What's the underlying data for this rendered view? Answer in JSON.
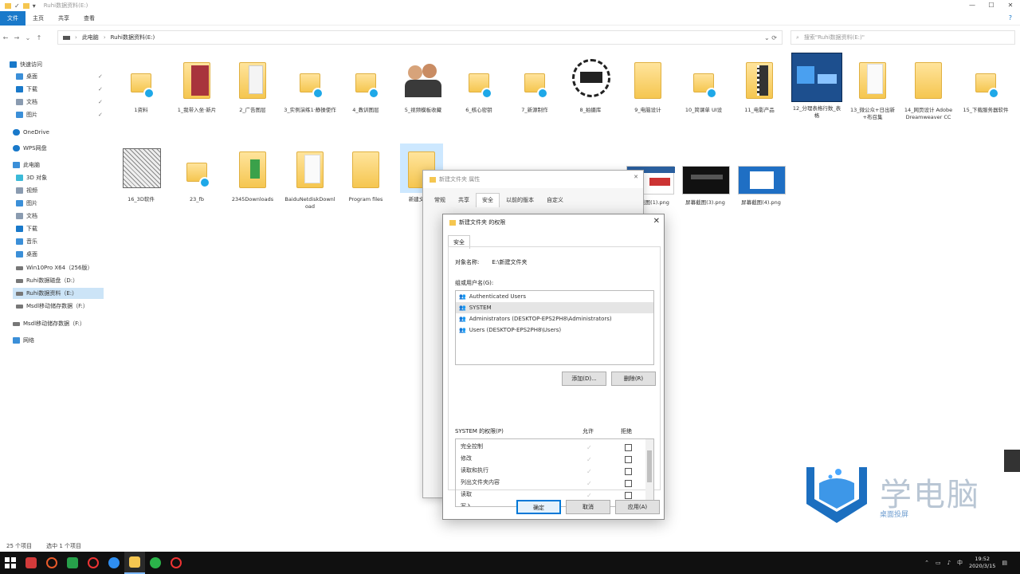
{
  "window": {
    "title": "Ruhi数据资料(E:)",
    "controls": [
      "—",
      "☐",
      "✕"
    ]
  },
  "ribbon": {
    "tabs": [
      "文件",
      "主页",
      "共享",
      "查看"
    ],
    "help": "?"
  },
  "address": {
    "path": [
      "此电脑",
      "Ruhi数据资料(E:)"
    ],
    "search_placeholder": "搜索\"Ruhi数据资料(E:)\""
  },
  "sidebar": {
    "items": [
      {
        "label": "快速访问",
        "color": "#1979ca"
      },
      {
        "label": "桌面",
        "color": "#3b8fd8",
        "pinned": true
      },
      {
        "label": "下载",
        "color": "#1979ca",
        "pinned": true
      },
      {
        "label": "文档",
        "color": "#8a9bb0",
        "pinned": true
      },
      {
        "label": "图片",
        "color": "#3b8fd8",
        "pinned": true
      },
      {
        "label": "OneDrive",
        "color": "#1979ca"
      },
      {
        "label": "WPS网盘",
        "color": "#1979ca"
      },
      {
        "label": "此电脑",
        "color": "#3b8fd8"
      },
      {
        "label": "3D 对象",
        "color": "#3bbad8"
      },
      {
        "label": "视频",
        "color": "#8a9bb0"
      },
      {
        "label": "图片",
        "color": "#3b8fd8"
      },
      {
        "label": "文档",
        "color": "#8a9bb0"
      },
      {
        "label": "下载",
        "color": "#1979ca"
      },
      {
        "label": "音乐",
        "color": "#3b8fd8"
      },
      {
        "label": "桌面",
        "color": "#3b8fd8"
      },
      {
        "label": "Win10Pro X64（256版）",
        "color": "#777777"
      },
      {
        "label": "Ruhi数据磁盘（D:）",
        "color": "#777777"
      },
      {
        "label": "Ruhi数据资料（E:）",
        "color": "#777777",
        "selected": true
      },
      {
        "label": "Msdl移动储存数据（F:）",
        "color": "#777777"
      },
      {
        "label": "Msdl移动储存数据（F:）",
        "color": "#777777"
      },
      {
        "label": "网络",
        "color": "#3b8fd8"
      }
    ]
  },
  "files_row1": [
    {
      "label": "1资料",
      "kind": "folder-badge"
    },
    {
      "label": "1_我带入坐·新片",
      "kind": "red-folder"
    },
    {
      "label": "2_广告图层",
      "kind": "folder-paper"
    },
    {
      "label": "3_实例演练1·静操使作",
      "kind": "folder-badge"
    },
    {
      "label": "4_教训图层",
      "kind": "folder-badge"
    },
    {
      "label": "5_视频模板收藏",
      "kind": "people"
    },
    {
      "label": "6_核心密钥",
      "kind": "folder-badge"
    },
    {
      "label": "7_新源制作",
      "kind": "folder-badge"
    },
    {
      "label": "8_拍摄库",
      "kind": "stamp"
    },
    {
      "label": "9_电脑设计",
      "kind": "folder"
    },
    {
      "label": "10_简课单 UI设",
      "kind": "folder-badge"
    },
    {
      "label": "11_电影产品",
      "kind": "folder-film"
    },
    {
      "label": "12_分理表格行数_表格",
      "kind": "blue-shot"
    },
    {
      "label": "13_微公众+日出新+布召集",
      "kind": "folder-paper"
    },
    {
      "label": "14_网页设计 Adobe Dreamweaver CC",
      "kind": "folder"
    },
    {
      "label": "15_下载服务器软件",
      "kind": "folder-badge"
    }
  ],
  "files_row2": [
    {
      "label": "16_3D软件",
      "kind": "sketch"
    },
    {
      "label": "23_fb",
      "kind": "folder-badge"
    },
    {
      "label": "2345Downloads",
      "kind": "folder-green"
    },
    {
      "label": "BaiduNetdiskDownload",
      "kind": "folder-paper"
    },
    {
      "label": "Program files",
      "kind": "folder"
    },
    {
      "label": "新建文件夹",
      "kind": "folder",
      "selected": true
    }
  ],
  "screenshots": [
    {
      "label": "屏幕截图(1).png",
      "bg": "#2a5f9e"
    },
    {
      "label": "屏幕截图(3).png",
      "bg": "#111111"
    },
    {
      "label": "屏幕截图(4).png",
      "bg": "#1f6fc4"
    }
  ],
  "back_dialog": {
    "title": "新建文件夹 属性",
    "tabs": [
      "常规",
      "共享",
      "安全",
      "以前的版本",
      "自定义"
    ],
    "active_tab": "安全"
  },
  "dialog": {
    "title": "新建文件夹 的权限",
    "tab": "安全",
    "object_label": "对象名称:",
    "object_value": "E:\\新建文件夹",
    "group_label": "组或用户名(G):",
    "users": [
      "Authenticated Users",
      "SYSTEM",
      "Administrators (DESKTOP-EPS2PH8\\Administrators)",
      "Users (DESKTOP-EPS2PH8\\Users)"
    ],
    "selected_user_index": 1,
    "add_button": "添加(D)...",
    "remove_button": "删除(R)",
    "perm_label": "SYSTEM 的权限(P)",
    "allow_label": "允许",
    "deny_label": "拒绝",
    "permissions": [
      "完全控制",
      "修改",
      "读取和执行",
      "列出文件夹内容",
      "读取",
      "写入"
    ],
    "ok": "确定",
    "cancel": "取消",
    "apply": "应用(A)"
  },
  "statusbar": {
    "count": "25 个项目",
    "selected": "选中 1 个项目"
  },
  "taskbar": {
    "time": "19:52",
    "date": "2020/3/15"
  },
  "watermark": {
    "title": "学电脑",
    "subtitle": "桌面投屏"
  }
}
